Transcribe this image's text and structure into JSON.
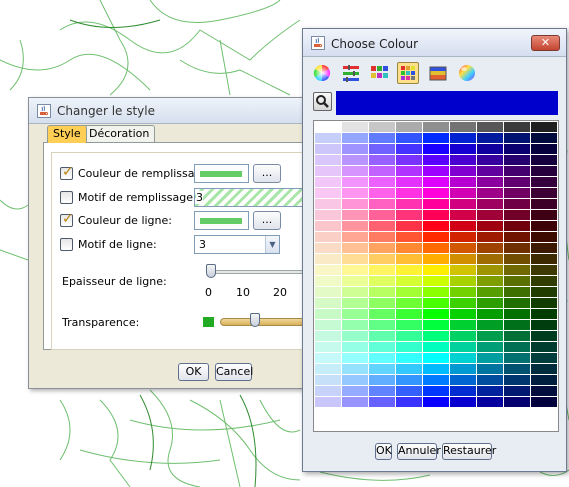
{
  "style_dialog": {
    "title": "Changer le style",
    "tabs": [
      "Style",
      "Décoration"
    ],
    "fill_color_label": "Couleur de remplissage:",
    "fill_color_checked": true,
    "fill_color_value": "#66cc66",
    "fill_pattern_label": "Motif de remplissage:",
    "fill_pattern_checked": false,
    "fill_pattern_value": "3",
    "line_color_label": "Couleur de ligne:",
    "line_color_checked": true,
    "line_color_value": "#66cc66",
    "line_pattern_label": "Motif de ligne:",
    "line_pattern_checked": false,
    "line_pattern_value": "3",
    "dots_button_label": "...",
    "line_width_label": "Epaisseur de ligne:",
    "line_width_ticks": [
      "0",
      "10",
      "20"
    ],
    "line_width_value": 0,
    "transparency_label": "Transparence:",
    "transparency_value_fraction": 0.35,
    "ok_label": "OK",
    "cancel_label": "Cancel"
  },
  "colour_dialog": {
    "title": "Choose Colour",
    "close_label": "✕",
    "modes": [
      {
        "icon": "colour-wheel-icon"
      },
      {
        "icon": "rgb-sliders-icon"
      },
      {
        "icon": "swatches-icon"
      },
      {
        "icon": "palette-grid-icon",
        "selected": true
      },
      {
        "icon": "crayon-box-icon"
      },
      {
        "icon": "colour-sphere-icon"
      }
    ],
    "selected_colour": "#0000cc",
    "ok_label": "OK",
    "cancel_label": "Annuler",
    "reset_label": "Restaurer"
  }
}
